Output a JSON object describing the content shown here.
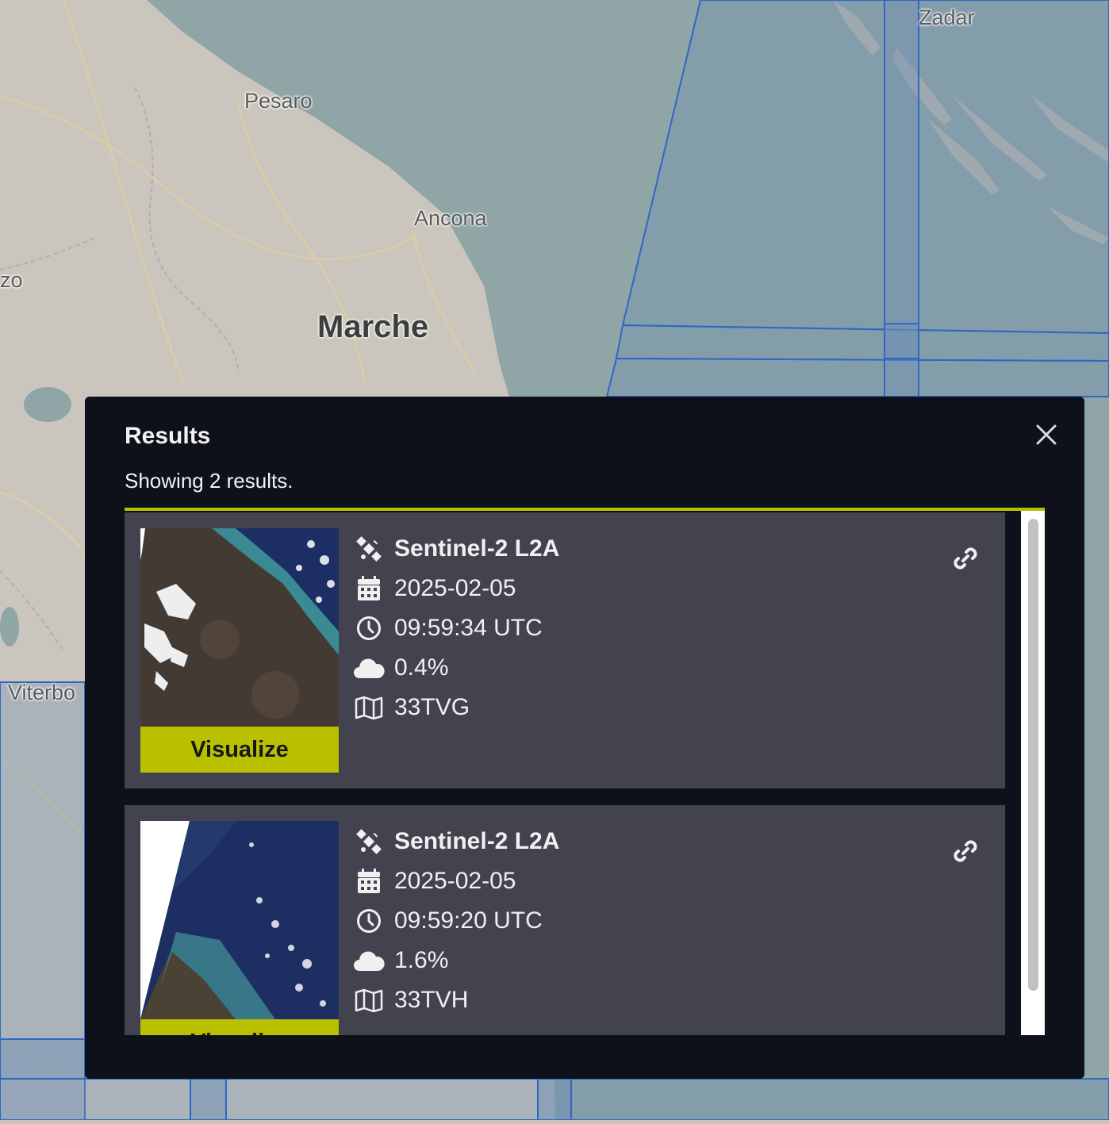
{
  "map": {
    "labels": {
      "pesaro": "Pesaro",
      "ancona": "Ancona",
      "marche": "Marche",
      "zadar": "Zadar",
      "viterbo": "Viterbo",
      "left_edge": "zo"
    },
    "colors": {
      "land": "#c9c4bc",
      "sea": "#8fa5a6",
      "tile_fill": "#6f8fb4",
      "tile_stroke": "#2f67c4"
    }
  },
  "results_panel": {
    "title": "Results",
    "count_text": "Showing 2 results.",
    "close_icon": "close-icon",
    "accent_color": "#b9c000",
    "results": [
      {
        "collection": "Sentinel-2 L2A",
        "date": "2025-02-05",
        "time": "09:59:34 UTC",
        "cloud_cover": "0.4%",
        "tile": "33TVG",
        "visualize_label": "Visualize",
        "icons": [
          "satellite-icon",
          "calendar-icon",
          "clock-icon",
          "cloud-icon",
          "map-icon",
          "link-icon"
        ]
      },
      {
        "collection": "Sentinel-2 L2A",
        "date": "2025-02-05",
        "time": "09:59:20 UTC",
        "cloud_cover": "1.6%",
        "tile": "33TVH",
        "visualize_label": "Visualize",
        "icons": [
          "satellite-icon",
          "calendar-icon",
          "clock-icon",
          "cloud-icon",
          "map-icon",
          "link-icon"
        ]
      }
    ]
  }
}
